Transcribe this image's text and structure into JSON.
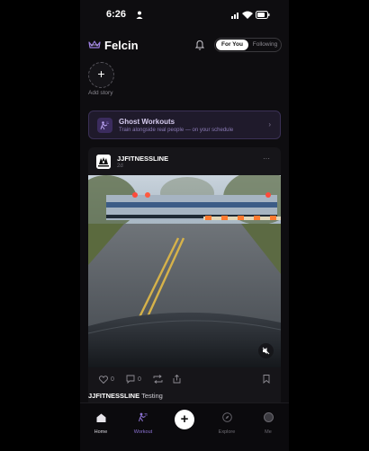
{
  "status_bar": {
    "time": "6:26"
  },
  "header": {
    "app_name": "Felcin",
    "tabs": [
      {
        "label": "For You",
        "active": true
      },
      {
        "label": "Following",
        "active": false
      }
    ]
  },
  "stories": {
    "add_label": "Add story",
    "add_symbol": "+"
  },
  "ghost_card": {
    "title": "Ghost Workouts",
    "subtitle": "Train alongside real people — on your schedule",
    "chevron": "›"
  },
  "post": {
    "username": "JJFITNESSLINE",
    "time_ago": "2d",
    "more": "···",
    "like_count": "0",
    "comment_count": "0",
    "caption_user": "JJFITNESSLINE",
    "caption_text": "Testing"
  },
  "nav": {
    "items": [
      {
        "label": "Home",
        "icon": "home-icon",
        "active": true
      },
      {
        "label": "Workout",
        "icon": "workout-icon",
        "active": false
      },
      {
        "label": "Explore",
        "icon": "compass-icon",
        "active": false
      },
      {
        "label": "Me",
        "icon": "avatar-icon",
        "active": false
      }
    ],
    "create_symbol": "+"
  },
  "colors": {
    "background": "#0e0d10",
    "accent": "#8e74d6",
    "ghost_card_bg": "#1f1a2b"
  }
}
